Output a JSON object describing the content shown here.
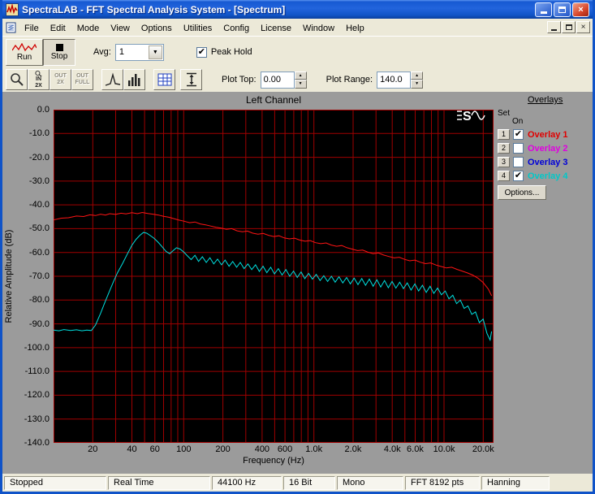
{
  "window": {
    "title": "SpectraLAB - FFT Spectral Analysis System - [Spectrum]"
  },
  "menu": {
    "items": [
      "File",
      "Edit",
      "Mode",
      "View",
      "Options",
      "Utilities",
      "Config",
      "License",
      "Window",
      "Help"
    ]
  },
  "toolbar": {
    "run_label": "Run",
    "stop_label": "Stop",
    "avg_label": "Avg:",
    "avg_value": "1",
    "peak_hold_label": "Peak Hold",
    "peak_hold_checked": true
  },
  "toolbar2": {
    "zoom_in_line1": "IN",
    "zoom_in_line2": "2X",
    "zoom_out_line1": "OUT",
    "zoom_out_line2": "2X",
    "zoom_full_line1": "OUT",
    "zoom_full_line2": "FULL",
    "plot_top_label": "Plot Top:",
    "plot_top_value": "0.00",
    "plot_range_label": "Plot Range:",
    "plot_range_value": "140.0"
  },
  "overlays": {
    "title": "Overlays",
    "col_set": "Set",
    "col_on": "On",
    "rows": [
      {
        "num": "1",
        "label": "Overlay 1",
        "checked": true,
        "color": "#e00000"
      },
      {
        "num": "2",
        "label": "Overlay 2",
        "checked": false,
        "color": "#e000e0"
      },
      {
        "num": "3",
        "label": "Overlay 3",
        "checked": false,
        "color": "#0000d8"
      },
      {
        "num": "4",
        "label": "Overlay 4",
        "checked": true,
        "color": "#00c8c8"
      }
    ],
    "options_label": "Options..."
  },
  "status_bar": {
    "panels": [
      "Stopped",
      "Real Time",
      "44100 Hz",
      "16 Bit",
      "Mono",
      "FFT 8192 pts",
      "Hanning"
    ]
  },
  "chart_data": {
    "type": "line",
    "title": "Left Channel",
    "xlabel": "Frequency (Hz)",
    "ylabel": "Relative Amplitude (dB)",
    "x_scale": "log",
    "x_range": [
      10,
      24000
    ],
    "y_range": [
      -140,
      0
    ],
    "colors": {
      "grid": "#a00000",
      "background": "#000000"
    },
    "x_gridlines": [
      20,
      30,
      40,
      50,
      60,
      70,
      80,
      90,
      100,
      200,
      300,
      400,
      500,
      600,
      700,
      800,
      900,
      1000,
      2000,
      3000,
      4000,
      5000,
      6000,
      7000,
      8000,
      9000,
      10000,
      20000
    ],
    "y_gridlines": [
      -10,
      -20,
      -30,
      -40,
      -50,
      -60,
      -70,
      -80,
      -90,
      -100,
      -110,
      -120,
      -130
    ],
    "x_ticks": [
      {
        "f": 20,
        "label": "20"
      },
      {
        "f": 40,
        "label": "40"
      },
      {
        "f": 60,
        "label": "60"
      },
      {
        "f": 100,
        "label": "100"
      },
      {
        "f": 200,
        "label": "200"
      },
      {
        "f": 400,
        "label": "400"
      },
      {
        "f": 600,
        "label": "600"
      },
      {
        "f": 1000,
        "label": "1.0k"
      },
      {
        "f": 2000,
        "label": "2.0k"
      },
      {
        "f": 4000,
        "label": "4.0k"
      },
      {
        "f": 6000,
        "label": "6.0k"
      },
      {
        "f": 10000,
        "label": "10.0k"
      },
      {
        "f": 20000,
        "label": "20.0k"
      }
    ],
    "y_ticks": [
      {
        "v": 0,
        "label": "0.0"
      },
      {
        "v": -10,
        "label": "-10.0"
      },
      {
        "v": -20,
        "label": "-20.0"
      },
      {
        "v": -30,
        "label": "-30.0"
      },
      {
        "v": -40,
        "label": "-40.0"
      },
      {
        "v": -50,
        "label": "-50.0"
      },
      {
        "v": -60,
        "label": "-60.0"
      },
      {
        "v": -70,
        "label": "-70.0"
      },
      {
        "v": -80,
        "label": "-80.0"
      },
      {
        "v": -90,
        "label": "-90.0"
      },
      {
        "v": -100,
        "label": "-100.0"
      },
      {
        "v": -110,
        "label": "-110.0"
      },
      {
        "v": -120,
        "label": "-120.0"
      },
      {
        "v": -130,
        "label": "-130.0"
      },
      {
        "v": -140,
        "label": "-140.0"
      }
    ],
    "series": [
      {
        "name": "Overlay 1",
        "color": "#ff1414",
        "points": [
          [
            10,
            -46.3
          ],
          [
            11.5,
            -45.6
          ],
          [
            13,
            -45.4
          ],
          [
            15,
            -44.7
          ],
          [
            17,
            -44.9
          ],
          [
            19,
            -44.2
          ],
          [
            21,
            -44.5
          ],
          [
            23,
            -43.9
          ],
          [
            25,
            -44.3
          ],
          [
            27,
            -43.7
          ],
          [
            30,
            -44.0
          ],
          [
            33,
            -43.5
          ],
          [
            36,
            -43.8
          ],
          [
            40,
            -43.3
          ],
          [
            44,
            -43.7
          ],
          [
            48,
            -43.2
          ],
          [
            53,
            -43.6
          ],
          [
            58,
            -43.9
          ],
          [
            64,
            -44.3
          ],
          [
            70,
            -44.8
          ],
          [
            77,
            -45.2
          ],
          [
            84,
            -45.8
          ],
          [
            92,
            -46.4
          ],
          [
            101,
            -46.9
          ],
          [
            111,
            -47.5
          ],
          [
            122,
            -47.2
          ],
          [
            134,
            -48.0
          ],
          [
            147,
            -48.4
          ],
          [
            161,
            -48.9
          ],
          [
            177,
            -49.4
          ],
          [
            194,
            -49.8
          ],
          [
            213,
            -50.3
          ],
          [
            234,
            -50.0
          ],
          [
            257,
            -50.9
          ],
          [
            282,
            -51.3
          ],
          [
            309,
            -51.0
          ],
          [
            339,
            -51.9
          ],
          [
            372,
            -52.3
          ],
          [
            408,
            -52.0
          ],
          [
            448,
            -52.8
          ],
          [
            491,
            -53.3
          ],
          [
            539,
            -53.0
          ],
          [
            591,
            -53.9
          ],
          [
            648,
            -54.3
          ],
          [
            711,
            -54.0
          ],
          [
            780,
            -54.8
          ],
          [
            856,
            -55.3
          ],
          [
            939,
            -55.0
          ],
          [
            1030,
            -55.9
          ],
          [
            1130,
            -56.3
          ],
          [
            1240,
            -56.0
          ],
          [
            1360,
            -56.9
          ],
          [
            1492,
            -57.4
          ],
          [
            1637,
            -57.1
          ],
          [
            1796,
            -58.0
          ],
          [
            1970,
            -58.6
          ],
          [
            2161,
            -59.2
          ],
          [
            2371,
            -59.0
          ],
          [
            2601,
            -59.9
          ],
          [
            2853,
            -60.5
          ],
          [
            3130,
            -60.2
          ],
          [
            3434,
            -61.1
          ],
          [
            3767,
            -61.7
          ],
          [
            4132,
            -62.3
          ],
          [
            4533,
            -62.0
          ],
          [
            4973,
            -62.9
          ],
          [
            5455,
            -63.5
          ],
          [
            5985,
            -63.2
          ],
          [
            6565,
            -64.1
          ],
          [
            7202,
            -64.7
          ],
          [
            7901,
            -64.4
          ],
          [
            8667,
            -65.3
          ],
          [
            9508,
            -65.9
          ],
          [
            10430,
            -66.5
          ],
          [
            11442,
            -66.2
          ],
          [
            12552,
            -67.1
          ],
          [
            13770,
            -67.8
          ],
          [
            15106,
            -68.6
          ],
          [
            16571,
            -69.5
          ],
          [
            18179,
            -70.8
          ],
          [
            19943,
            -72.6
          ],
          [
            21878,
            -75.4
          ],
          [
            23200,
            -78.2
          ]
        ]
      },
      {
        "name": "Overlay 4",
        "color": "#00e0e0",
        "points": [
          [
            10,
            -92.6
          ],
          [
            11,
            -92.9
          ],
          [
            12,
            -92.4
          ],
          [
            13.5,
            -92.8
          ],
          [
            15,
            -92.5
          ],
          [
            16.5,
            -92.9
          ],
          [
            18,
            -92.6
          ],
          [
            19.5,
            -92.8
          ],
          [
            21,
            -90.5
          ],
          [
            23,
            -85.5
          ],
          [
            25,
            -80.5
          ],
          [
            27,
            -76.0
          ],
          [
            29,
            -72.0
          ],
          [
            31,
            -68.5
          ],
          [
            34,
            -64.5
          ],
          [
            37,
            -60.5
          ],
          [
            40,
            -57.0
          ],
          [
            43,
            -54.5
          ],
          [
            46,
            -52.8
          ],
          [
            49,
            -51.6
          ],
          [
            52,
            -51.9
          ],
          [
            55,
            -52.8
          ],
          [
            59,
            -54.0
          ],
          [
            63,
            -55.5
          ],
          [
            68,
            -57.5
          ],
          [
            73,
            -59.5
          ],
          [
            78,
            -60.5
          ],
          [
            83,
            -59.2
          ],
          [
            88,
            -58.0
          ],
          [
            94,
            -58.6
          ],
          [
            100,
            -59.8
          ],
          [
            107,
            -61.5
          ],
          [
            114,
            -63.0
          ],
          [
            122,
            -61.2
          ],
          [
            130,
            -63.8
          ],
          [
            139,
            -61.8
          ],
          [
            149,
            -64.2
          ],
          [
            159,
            -62.2
          ],
          [
            170,
            -64.8
          ],
          [
            182,
            -62.8
          ],
          [
            195,
            -65.2
          ],
          [
            208,
            -63.2
          ],
          [
            223,
            -65.8
          ],
          [
            238,
            -63.8
          ],
          [
            255,
            -66.2
          ],
          [
            272,
            -64.2
          ],
          [
            291,
            -66.8
          ],
          [
            311,
            -64.8
          ],
          [
            333,
            -67.2
          ],
          [
            356,
            -65.2
          ],
          [
            381,
            -68.0
          ],
          [
            407,
            -65.8
          ],
          [
            435,
            -68.5
          ],
          [
            466,
            -66.2
          ],
          [
            498,
            -69.0
          ],
          [
            533,
            -66.8
          ],
          [
            570,
            -69.5
          ],
          [
            609,
            -67.2
          ],
          [
            652,
            -70.0
          ],
          [
            697,
            -67.8
          ],
          [
            745,
            -70.5
          ],
          [
            797,
            -68.2
          ],
          [
            852,
            -71.0
          ],
          [
            911,
            -68.8
          ],
          [
            975,
            -71.2
          ],
          [
            1042,
            -69.2
          ],
          [
            1115,
            -71.8
          ],
          [
            1192,
            -69.8
          ],
          [
            1275,
            -72.2
          ],
          [
            1363,
            -70.0
          ],
          [
            1458,
            -72.5
          ],
          [
            1559,
            -70.2
          ],
          [
            1667,
            -72.8
          ],
          [
            1783,
            -70.5
          ],
          [
            1907,
            -73.2
          ],
          [
            2039,
            -70.8
          ],
          [
            2181,
            -73.5
          ],
          [
            2332,
            -71.0
          ],
          [
            2494,
            -73.8
          ],
          [
            2667,
            -71.2
          ],
          [
            2852,
            -74.2
          ],
          [
            3050,
            -71.5
          ],
          [
            3262,
            -74.5
          ],
          [
            3488,
            -71.8
          ],
          [
            3730,
            -74.8
          ],
          [
            3989,
            -72.2
          ],
          [
            4266,
            -75.0
          ],
          [
            4562,
            -72.5
          ],
          [
            4878,
            -75.2
          ],
          [
            5217,
            -72.8
          ],
          [
            5579,
            -75.8
          ],
          [
            5966,
            -73.2
          ],
          [
            6380,
            -76.2
          ],
          [
            6823,
            -73.8
          ],
          [
            7297,
            -76.8
          ],
          [
            7803,
            -74.2
          ],
          [
            8345,
            -77.2
          ],
          [
            8924,
            -75.0
          ],
          [
            9543,
            -77.8
          ],
          [
            10206,
            -76.2
          ],
          [
            10914,
            -79.5
          ],
          [
            11672,
            -78.0
          ],
          [
            12482,
            -81.5
          ],
          [
            13348,
            -80.0
          ],
          [
            14275,
            -83.5
          ],
          [
            15266,
            -82.5
          ],
          [
            16325,
            -86.0
          ],
          [
            17458,
            -85.0
          ],
          [
            18670,
            -89.5
          ],
          [
            19966,
            -88.0
          ],
          [
            21352,
            -94.0
          ],
          [
            22600,
            -96.8
          ],
          [
            23200,
            -93.2
          ]
        ]
      }
    ]
  }
}
